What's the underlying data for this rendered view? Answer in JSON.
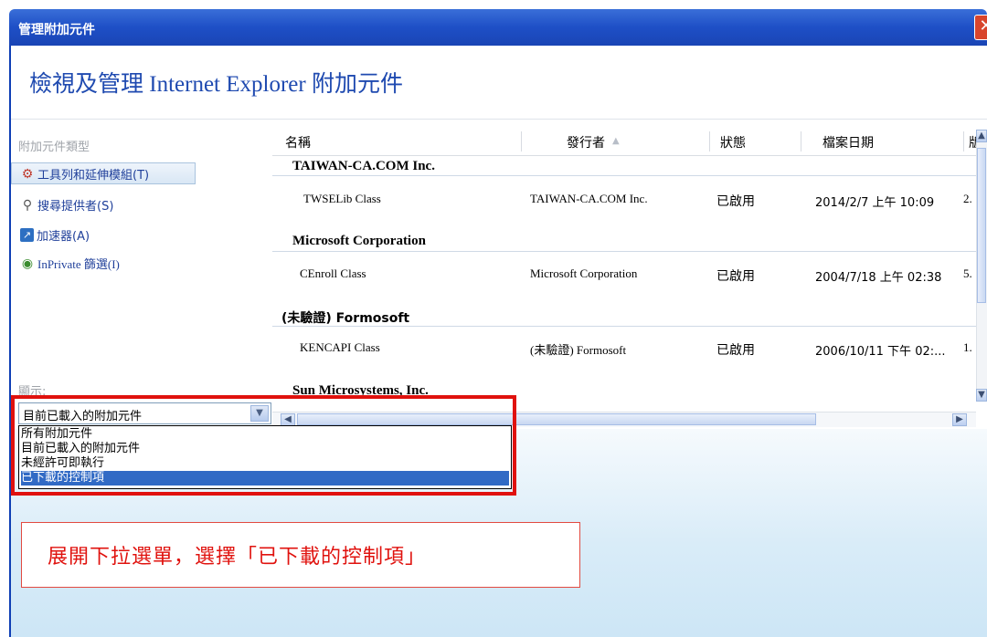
{
  "window": {
    "title": "管理附加元件"
  },
  "header": {
    "title": "檢視及管理 Internet Explorer 附加元件"
  },
  "left_panel": {
    "caption": "附加元件類型",
    "categories": [
      {
        "label": "工具列和延伸模組(T)",
        "icon": "gear-icon"
      },
      {
        "label": "搜尋提供者(S)",
        "icon": "search-icon"
      },
      {
        "label": "加速器(A)",
        "icon": "accelerator-icon"
      },
      {
        "label": "InPrivate 篩選(I)",
        "icon": "inprivate-icon"
      }
    ],
    "show_label": "顯示:",
    "show_select": {
      "value": "目前已載入的附加元件",
      "options": [
        "所有附加元件",
        "目前已載入的附加元件",
        "未經許可即執行",
        "已下載的控制項"
      ],
      "selected_index": 3
    }
  },
  "list": {
    "columns": [
      "名稱",
      "發行者",
      "狀態",
      "檔案日期",
      "版"
    ],
    "sort_indicator": "▲",
    "groups": [
      {
        "name": "TAIWAN-CA.COM Inc.",
        "rows": [
          {
            "name": "TWSELib Class",
            "publisher": "TAIWAN-CA.COM Inc.",
            "status": "已啟用",
            "date": "2014/2/7 上午 10:09",
            "version": "2."
          }
        ]
      },
      {
        "name": "Microsoft Corporation",
        "rows": [
          {
            "name": "CEnroll Class",
            "publisher": "Microsoft Corporation",
            "status": "已啟用",
            "date": "2004/7/18 上午 02:38",
            "version": "5."
          }
        ]
      },
      {
        "name": "(未驗證) Formosoft",
        "rows": [
          {
            "name": "KENCAPI Class",
            "publisher": "(未驗證) Formosoft",
            "status": "已啟用",
            "date": "2006/10/11 下午 02:...",
            "version": "1."
          }
        ]
      },
      {
        "name": "Sun Microsystems, Inc.",
        "rows": []
      }
    ]
  },
  "annotation": {
    "text": "展開下拉選單，選擇「已下載的控制項」",
    "color": "#e0120e"
  },
  "colors": {
    "titlebar": "#1e4fc6",
    "selection": "#316ac5",
    "accent_text": "#1f4ab0"
  }
}
